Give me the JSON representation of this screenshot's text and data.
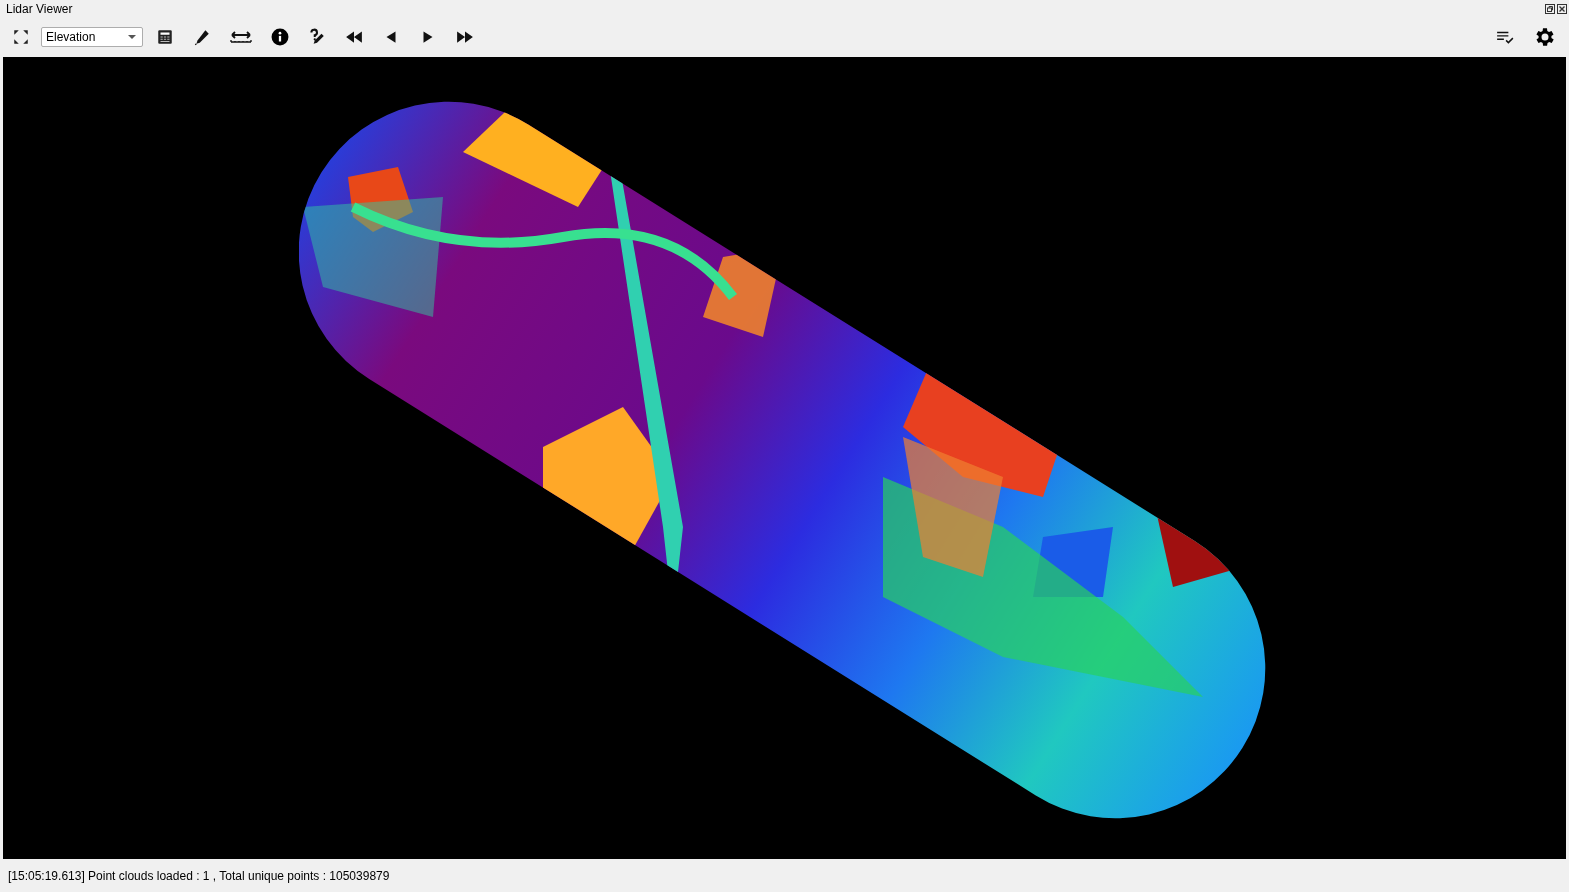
{
  "window": {
    "title": "Lidar Viewer"
  },
  "toolbar": {
    "color_mode": {
      "value": "Elevation"
    }
  },
  "status_bar": {
    "message": "[15:05:19.613] Point clouds loaded : 1 , Total unique points : 105039879"
  }
}
